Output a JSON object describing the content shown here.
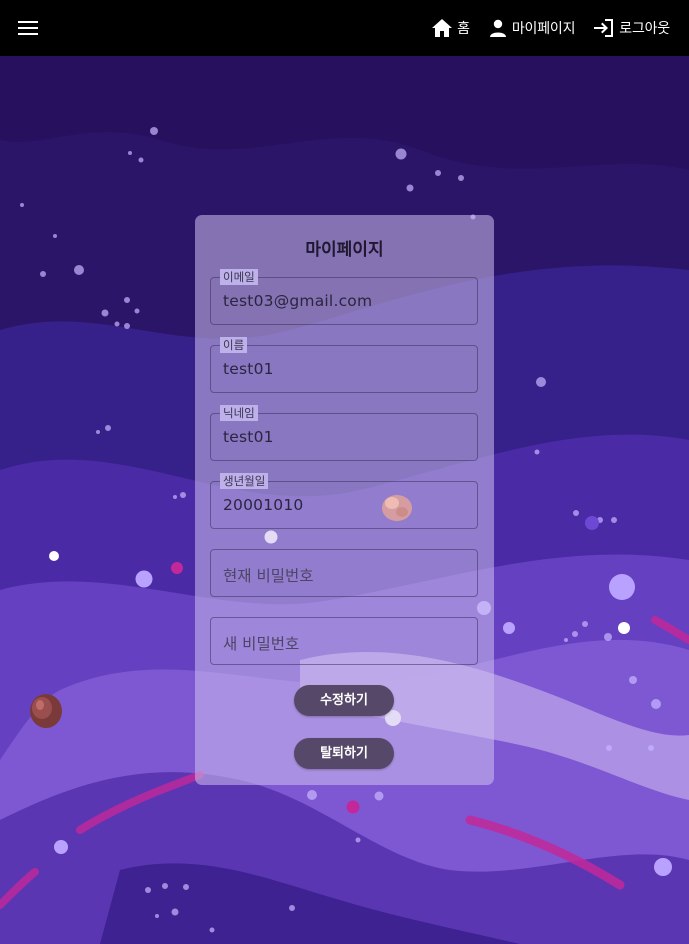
{
  "app_bar": {
    "menu_icon": "menu-icon",
    "nav": [
      {
        "icon": "home-icon",
        "label": "홈"
      },
      {
        "icon": "person-icon",
        "label": "마이페이지"
      },
      {
        "icon": "logout-icon",
        "label": "로그아웃"
      }
    ],
    "background_color": "#000000"
  },
  "card": {
    "title": "마이페이지",
    "fields": {
      "email": {
        "label": "이메일",
        "value": "test03@gmail.com"
      },
      "name": {
        "label": "이름",
        "value": "test01"
      },
      "nickname": {
        "label": "닉네임",
        "value": "test01"
      },
      "birthdate": {
        "label": "생년월일",
        "value": "20001010"
      },
      "current_password": {
        "placeholder": "현재 비밀번호"
      },
      "new_password": {
        "placeholder": "새 비밀번호"
      }
    },
    "buttons": {
      "update": "수정하기",
      "withdraw": "탈퇴하기"
    }
  },
  "colors": {
    "accent_button": "#564868",
    "background_deep": "#2a1468",
    "background_light": "#8e6ad6",
    "accent_pink": "#c2289a"
  }
}
